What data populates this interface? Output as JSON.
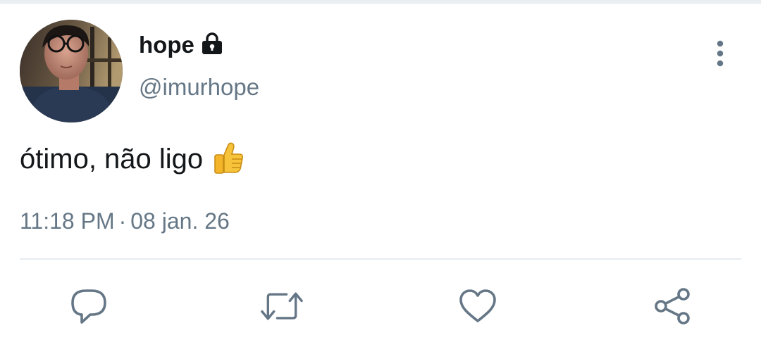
{
  "tweet": {
    "display_name": "hope",
    "handle": "@imurhope",
    "text": "ótimo, não ligo",
    "emoji": "thumbs-up",
    "time": "11:18 PM",
    "separator": "·",
    "date": "08 jan. 26"
  },
  "icons": {
    "lock": "lock-icon",
    "more": "more-vertical-icon",
    "reply": "reply-icon",
    "retweet": "retweet-icon",
    "like": "heart-icon",
    "share": "share-icon"
  },
  "colors": {
    "primary_text": "#14171a",
    "secondary_text": "#657786",
    "divider": "#e6ecf0"
  }
}
